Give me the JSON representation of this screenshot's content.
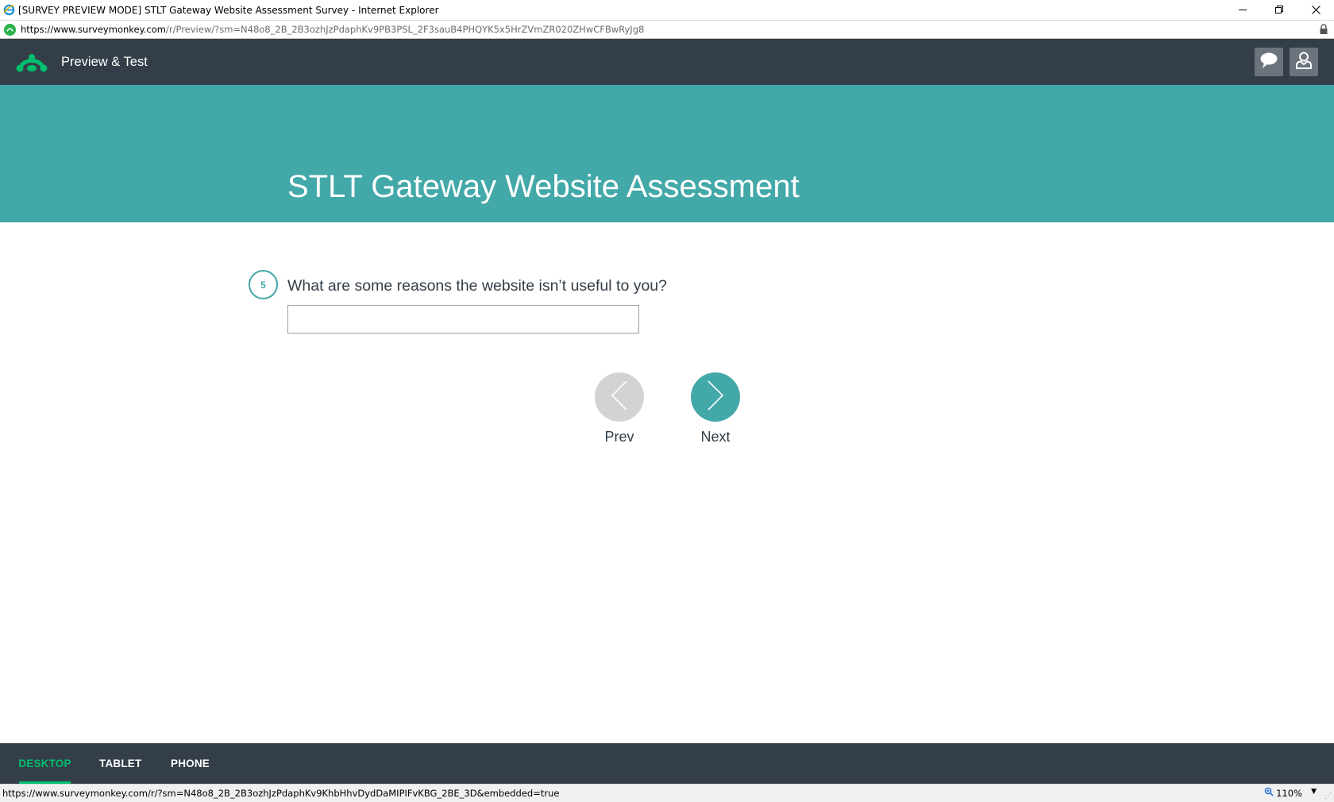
{
  "window": {
    "title": "[SURVEY PREVIEW MODE] STLT Gateway Website Assessment Survey - Internet Explorer",
    "minimize_icon": "minimize-icon",
    "restore_icon": "restore-icon",
    "close_icon": "close-icon"
  },
  "address_bar": {
    "url_prefix": "https://www.",
    "url_host": "surveymonkey.com",
    "url_rest": "/r/Preview/?sm=N48o8_2B_2B3ozhJzPdaphKv9PB3PSL_2F3sauB4PHQYK5x5HrZVmZR020ZHwCFBwRyJg8"
  },
  "header": {
    "title": "Preview & Test",
    "logo_icon": "surveymonkey-logo-icon",
    "comment_icon": "comment-icon",
    "user_icon": "user-icon"
  },
  "survey": {
    "title": "STLT Gateway Website Assessment"
  },
  "question": {
    "number": "5",
    "text": "What are some reasons the website isn’t useful to you?",
    "answer": ""
  },
  "nav": {
    "prev_label": "Prev",
    "next_label": "Next"
  },
  "device_tabs": [
    {
      "label": "DESKTOP",
      "active": true
    },
    {
      "label": "TABLET",
      "active": false
    },
    {
      "label": "PHONE",
      "active": false
    }
  ],
  "status_bar": {
    "url": "https://www.surveymonkey.com/r/?sm=N48o8_2B_2B3ozhJzPdaphKv9KhbHhvDydDaMIPIFvKBG_2BE_3D&embedded=true",
    "zoom": "110%"
  },
  "colors": {
    "header_bg": "#333e48",
    "banner_bg": "#43a8a8",
    "accent_green": "#00bf6f"
  }
}
